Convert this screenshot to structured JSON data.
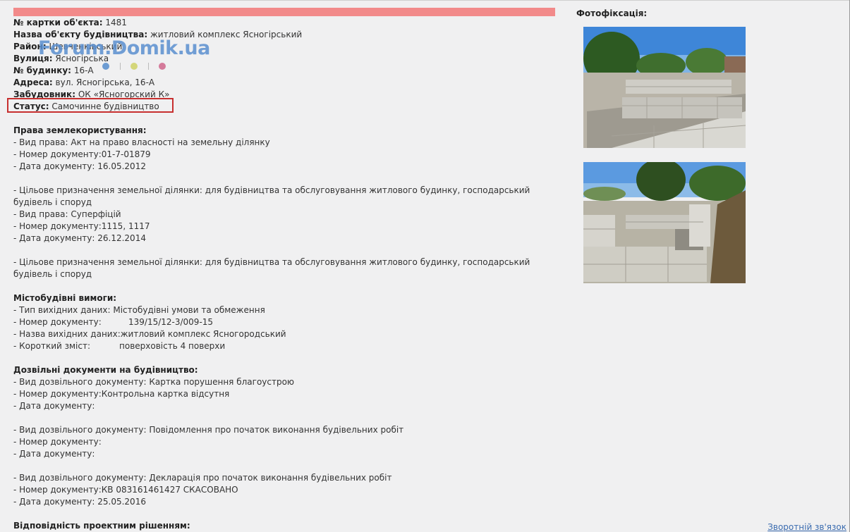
{
  "header": {
    "card_no_label": "№ картки об'єкта:",
    "card_no": "1481",
    "name_label": "Назва об'єкту будівництва:",
    "name": "житловий комплекс Ясногірський",
    "district_label": "Район:",
    "district": "Шевченківський",
    "street_label": "Вулиця:",
    "street": "Ясногірська",
    "house_label": "№ будинку:",
    "house": "16-А",
    "address_label": "Адреса:",
    "address": "вул. Ясногірська, 16-А",
    "developer_label": "Забудовник:",
    "developer": "ОК «Ясногорский К»",
    "status_label": "Статус:",
    "status": "Самочинне будівництво"
  },
  "watermark": {
    "text": "Forum.Domik.ua",
    "dot_colors": [
      "#6c9bd2",
      "#d4d67a",
      "#d47a9a"
    ]
  },
  "land": {
    "title": "Права землекористування:",
    "b1": {
      "kind": "- Вид права: Акт на право власності на земельну ділянку",
      "num": "- Номер документу:01-7-01879",
      "date": "- Дата документу:  16.05.2012"
    },
    "b2": {
      "purpose": "- Цільове призначення земельної ділянки: для будівництва та обслуговування житлового будинку, господарський будівель і споруд",
      "kind": "- Вид права: Суперфіцій",
      "num": "- Номер документу:1115, 1117",
      "date": "- Дата документу:  26.12.2014"
    },
    "b3": {
      "purpose": "- Цільове призначення земельної ділянки: для будівництва та обслуговування житлового будинку, господарський будівель і споруд"
    }
  },
  "urban": {
    "title": "Містобудівні вимоги:",
    "type": "- Тип вихідних даних: Містобудівні умови та обмеження",
    "num_label": "- Номер документу:",
    "num": "139/15/12-3/009-15",
    "name": "- Назва вихідних даних:житловий комплекс Ясногородський",
    "summary_label": "- Короткий зміст:",
    "summary": "поверховість 4 поверхи"
  },
  "permits": {
    "title": "Дозвільні документи на будівництво:",
    "p1": {
      "kind": "- Вид дозвільного документу: Картка порушення благоустрою",
      "num": "- Номер документу:Контрольна картка відсутня",
      "date": "- Дата документу:"
    },
    "p2": {
      "kind": "- Вид дозвільного документу: Повідомлення про початок виконання будівельних робіт",
      "num": "- Номер документу:",
      "date": "- Дата документу:"
    },
    "p3": {
      "kind": "- Вид дозвільного документу: Декларація про початок виконання будівельних робіт",
      "num": "- Номер документу:КВ 083161461427 СКАСОВАНО",
      "date": "- Дата документу:  25.05.2016"
    }
  },
  "compliance": {
    "title": "Відповідність проектним рішенням:"
  },
  "photos": {
    "title": "Фотофіксація:"
  },
  "footer": {
    "feedback": "Зворотній зв'язок"
  }
}
